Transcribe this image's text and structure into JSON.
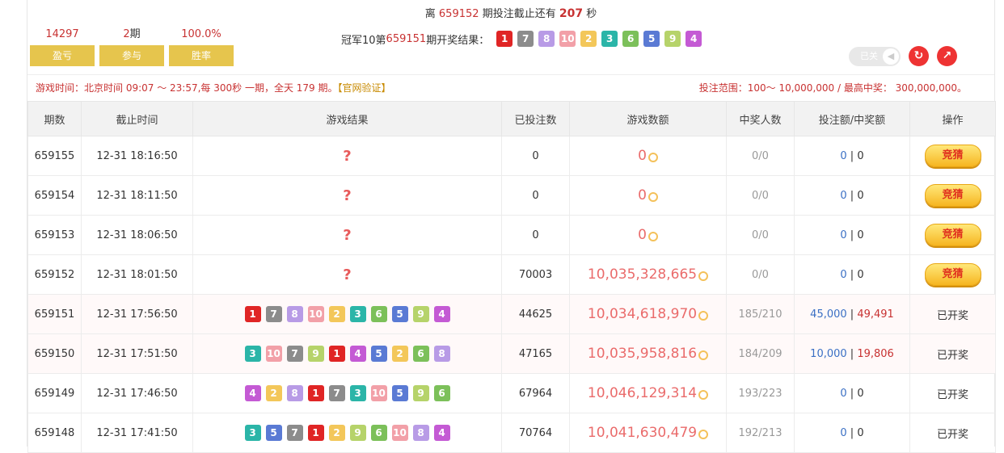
{
  "header": {
    "countdown": {
      "prefix": "离",
      "period": "659152",
      "middle": "期投注截止还有",
      "seconds": "207",
      "suffix": "秒"
    },
    "stats": [
      {
        "value": "14297",
        "label": "盈亏"
      },
      {
        "value": "2",
        "unit": "期",
        "label": "参与"
      },
      {
        "value": "100.0%",
        "label": "胜率"
      }
    ],
    "last_result": {
      "prefix": "冠军10第",
      "period": "659151",
      "suffix": "期开奖结果：",
      "balls": [
        1,
        7,
        8,
        10,
        2,
        3,
        6,
        5,
        9,
        4
      ]
    },
    "sound_label": "已关",
    "refresh_icon": "refresh-icon",
    "trend_icon": "trend-icon"
  },
  "info": {
    "time_text": "游戏时间：北京时间 09:07 ～ 23:57,每 300秒 一期，全天 179 期。",
    "verify_link": "【官网验证】",
    "range_text": "投注范围：100～ 10,000,000 / 最高中奖： 300,000,000。"
  },
  "table": {
    "headers": [
      "期数",
      "截止时间",
      "游戏结果",
      "已投注数",
      "游戏数额",
      "中奖人数",
      "投注额/中奖额",
      "操作"
    ],
    "rows": [
      {
        "period": "659155",
        "time": "12-31 18:16:50",
        "result": "?",
        "bets": "0",
        "amount": "0",
        "winners": "0/0",
        "bet_amt": "0",
        "win_amt": "0",
        "action": "竞猜",
        "open": false
      },
      {
        "period": "659154",
        "time": "12-31 18:11:50",
        "result": "?",
        "bets": "0",
        "amount": "0",
        "winners": "0/0",
        "bet_amt": "0",
        "win_amt": "0",
        "action": "竞猜",
        "open": false
      },
      {
        "period": "659153",
        "time": "12-31 18:06:50",
        "result": "?",
        "bets": "0",
        "amount": "0",
        "winners": "0/0",
        "bet_amt": "0",
        "win_amt": "0",
        "action": "竞猜",
        "open": false
      },
      {
        "period": "659152",
        "time": "12-31 18:01:50",
        "result": "?",
        "bets": "70003",
        "amount": "10,035,328,665",
        "winners": "0/0",
        "bet_amt": "0",
        "win_amt": "0",
        "action": "竞猜",
        "open": false
      },
      {
        "period": "659151",
        "time": "12-31 17:56:50",
        "balls": [
          1,
          7,
          8,
          10,
          2,
          3,
          6,
          5,
          9,
          4
        ],
        "bets": "44625",
        "amount": "10,034,618,970",
        "winners": "185/210",
        "bet_amt": "45,000",
        "win_amt": "49,491",
        "action": "已开奖",
        "open": true
      },
      {
        "period": "659150",
        "time": "12-31 17:51:50",
        "balls": [
          3,
          10,
          7,
          9,
          1,
          4,
          5,
          2,
          6,
          8
        ],
        "bets": "47165",
        "amount": "10,035,958,816",
        "winners": "184/209",
        "bet_amt": "10,000",
        "win_amt": "19,806",
        "action": "已开奖",
        "open": true
      },
      {
        "period": "659149",
        "time": "12-31 17:46:50",
        "balls": [
          4,
          2,
          8,
          1,
          7,
          3,
          10,
          5,
          9,
          6
        ],
        "bets": "67964",
        "amount": "10,046,129,314",
        "winners": "193/223",
        "bet_amt": "0",
        "win_amt": "0",
        "action": "已开奖",
        "open": false
      },
      {
        "period": "659148",
        "time": "12-31 17:41:50",
        "balls": [
          3,
          5,
          7,
          1,
          2,
          9,
          6,
          10,
          8,
          4
        ],
        "bets": "70764",
        "amount": "10,041,630,479",
        "winners": "192/213",
        "bet_amt": "0",
        "win_amt": "0",
        "action": "已开奖",
        "open": false
      }
    ]
  },
  "ball_colors": {
    "1": "#e02525",
    "2": "#f3c75a",
    "3": "#2bb5a8",
    "4": "#c45ad4",
    "5": "#5a7ad4",
    "6": "#7cc05a",
    "7": "#8c8c8c",
    "8": "#b89be6",
    "9": "#b6d36a",
    "10": "#f2a0a8"
  }
}
